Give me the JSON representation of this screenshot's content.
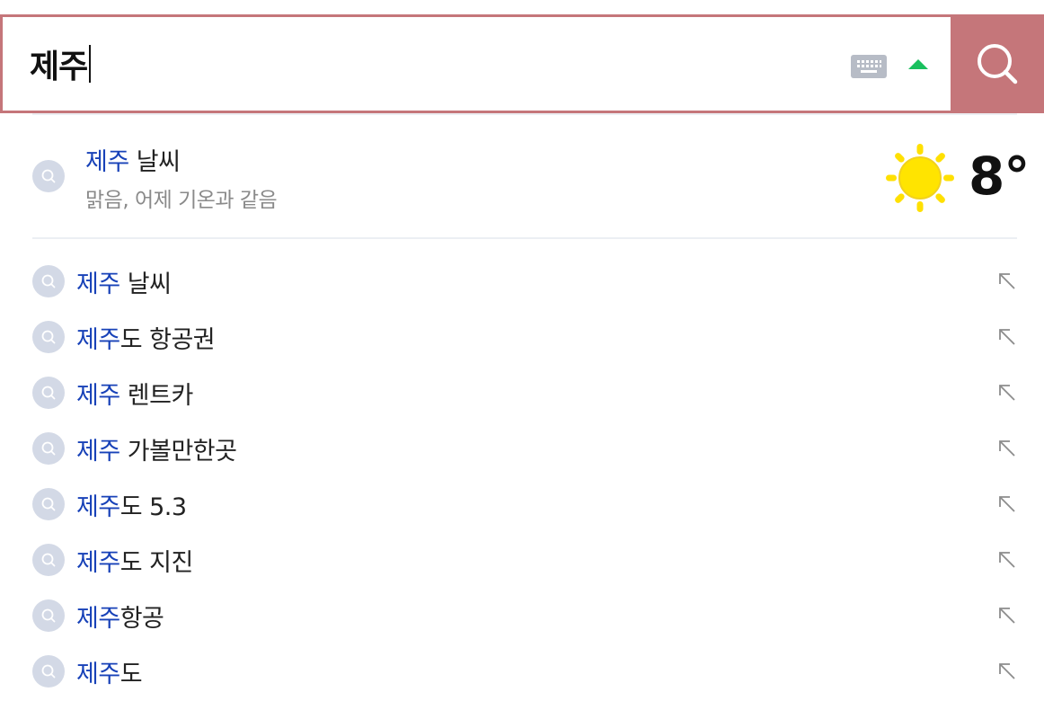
{
  "search": {
    "query": "제주",
    "submit_icon": "search-icon",
    "keyboard_icon": "keyboard-icon",
    "collapse_icon": "caret-up-icon",
    "accent_color": "#c5767a",
    "collapse_color": "#19c05e"
  },
  "weather": {
    "keyword": "제주",
    "suffix": " 날씨",
    "subtitle": "맑음, 어제 기온과 같음",
    "temperature": "8°",
    "icon": "sun-icon"
  },
  "suggestions": [
    {
      "match": "제주",
      "rest": " 날씨"
    },
    {
      "match": "제주",
      "rest": "도 항공권"
    },
    {
      "match": "제주",
      "rest": " 렌트카"
    },
    {
      "match": "제주",
      "rest": " 가볼만한곳"
    },
    {
      "match": "제주",
      "rest": "도 5.3"
    },
    {
      "match": "제주",
      "rest": "도 지진"
    },
    {
      "match": "제주",
      "rest": "항공"
    },
    {
      "match": "제주",
      "rest": "도"
    }
  ],
  "highlight_color": "#1842b8"
}
